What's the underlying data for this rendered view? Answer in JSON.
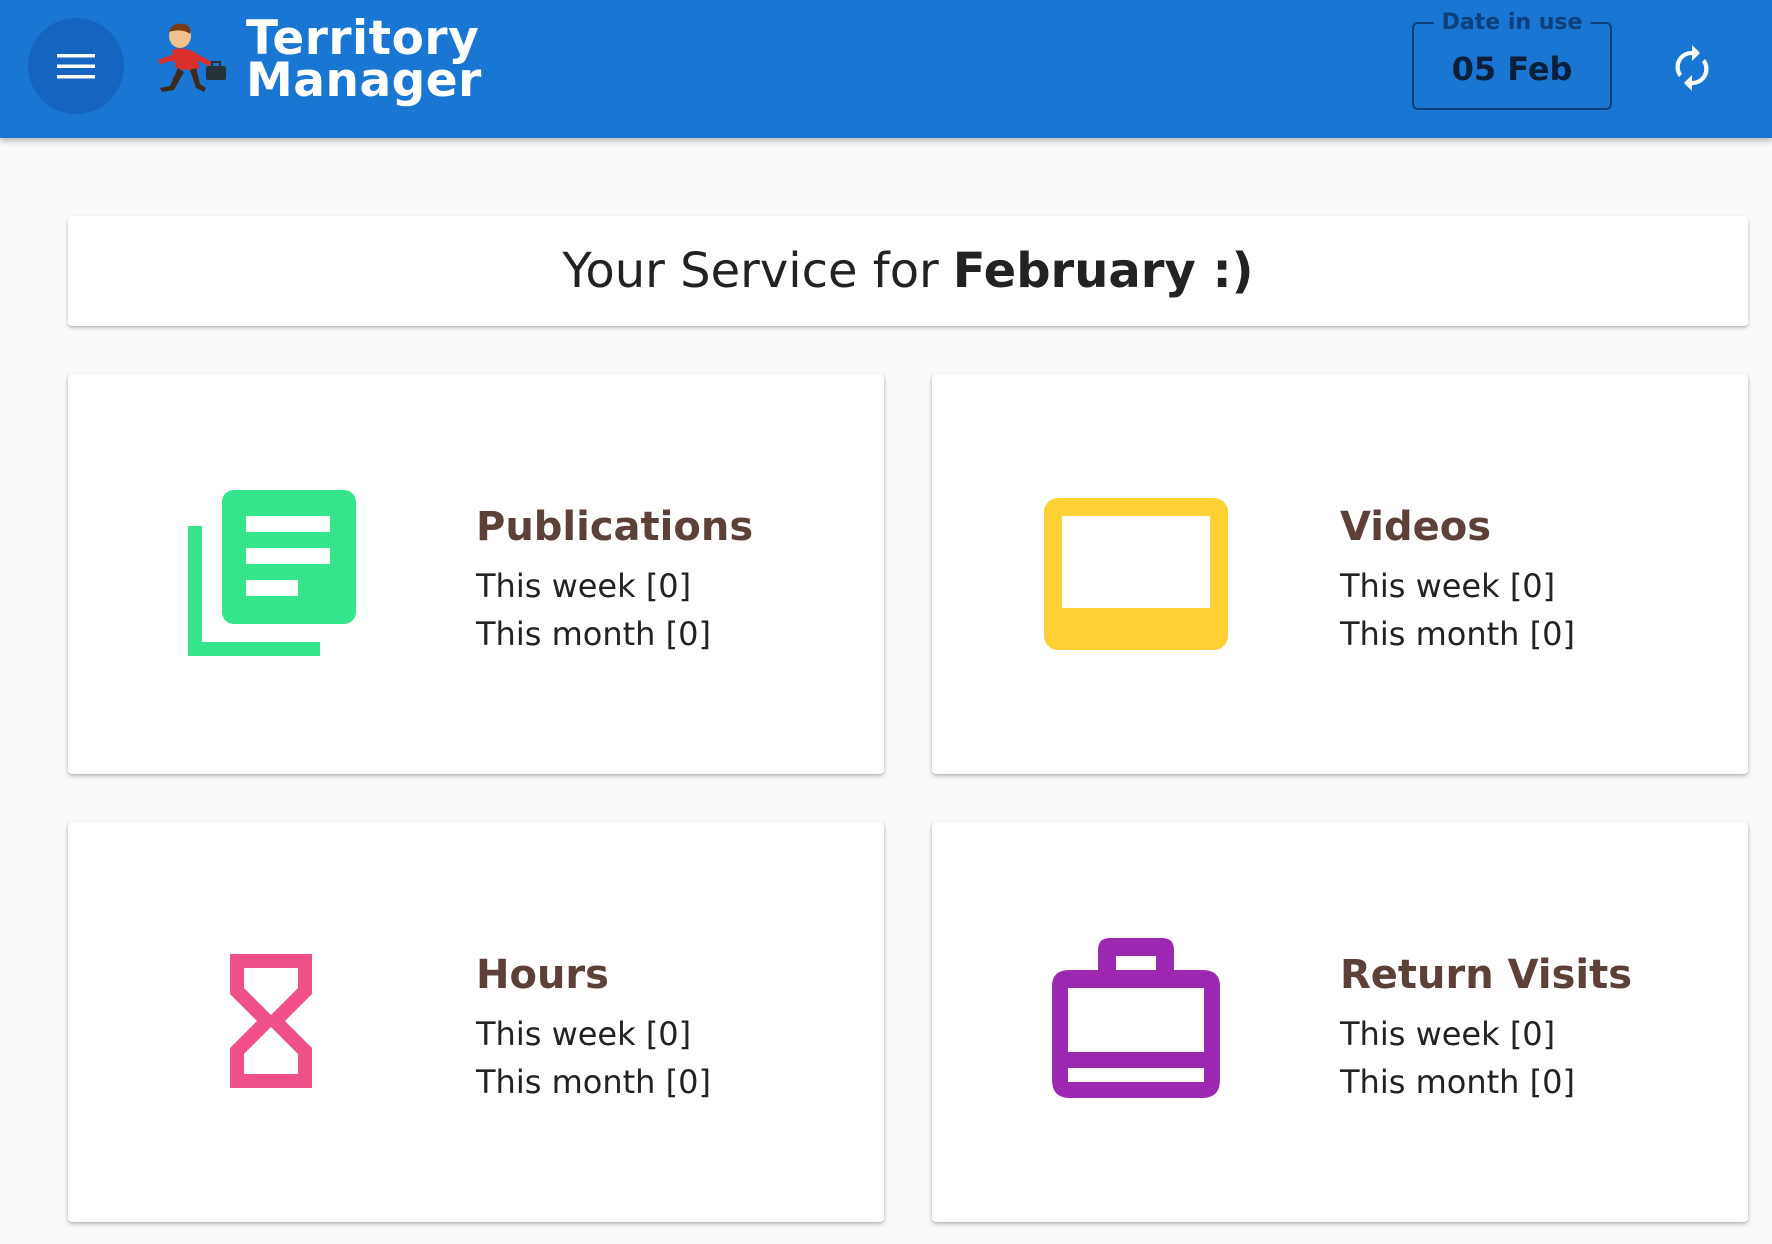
{
  "app": {
    "title_line1": "Territory",
    "title_line2": "Manager"
  },
  "header": {
    "date_label": "Date in use",
    "date_value": "05 Feb",
    "menu_icon": "hamburger-menu-icon",
    "sync_icon": "sync-icon"
  },
  "banner": {
    "prefix": "Your Service for",
    "month": "February :)"
  },
  "cards": [
    {
      "title": "Publications",
      "icon": "publications-icon",
      "color": "#34e58b",
      "week": "This week [0]",
      "month": "This month [0]"
    },
    {
      "title": "Videos",
      "icon": "video-icon",
      "color": "#fdd034",
      "week": "This week [0]",
      "month": "This month [0]"
    },
    {
      "title": "Hours",
      "icon": "hourglass-icon",
      "color": "#f0508a",
      "week": "This week [0]",
      "month": "This month [0]"
    },
    {
      "title": "Return Visits",
      "icon": "briefcase-icon",
      "color": "#9c27b0",
      "week": "This week [0]",
      "month": "This month [0]"
    }
  ],
  "colors": {
    "appbar": "#1976d2",
    "card_title": "#5d4037"
  }
}
